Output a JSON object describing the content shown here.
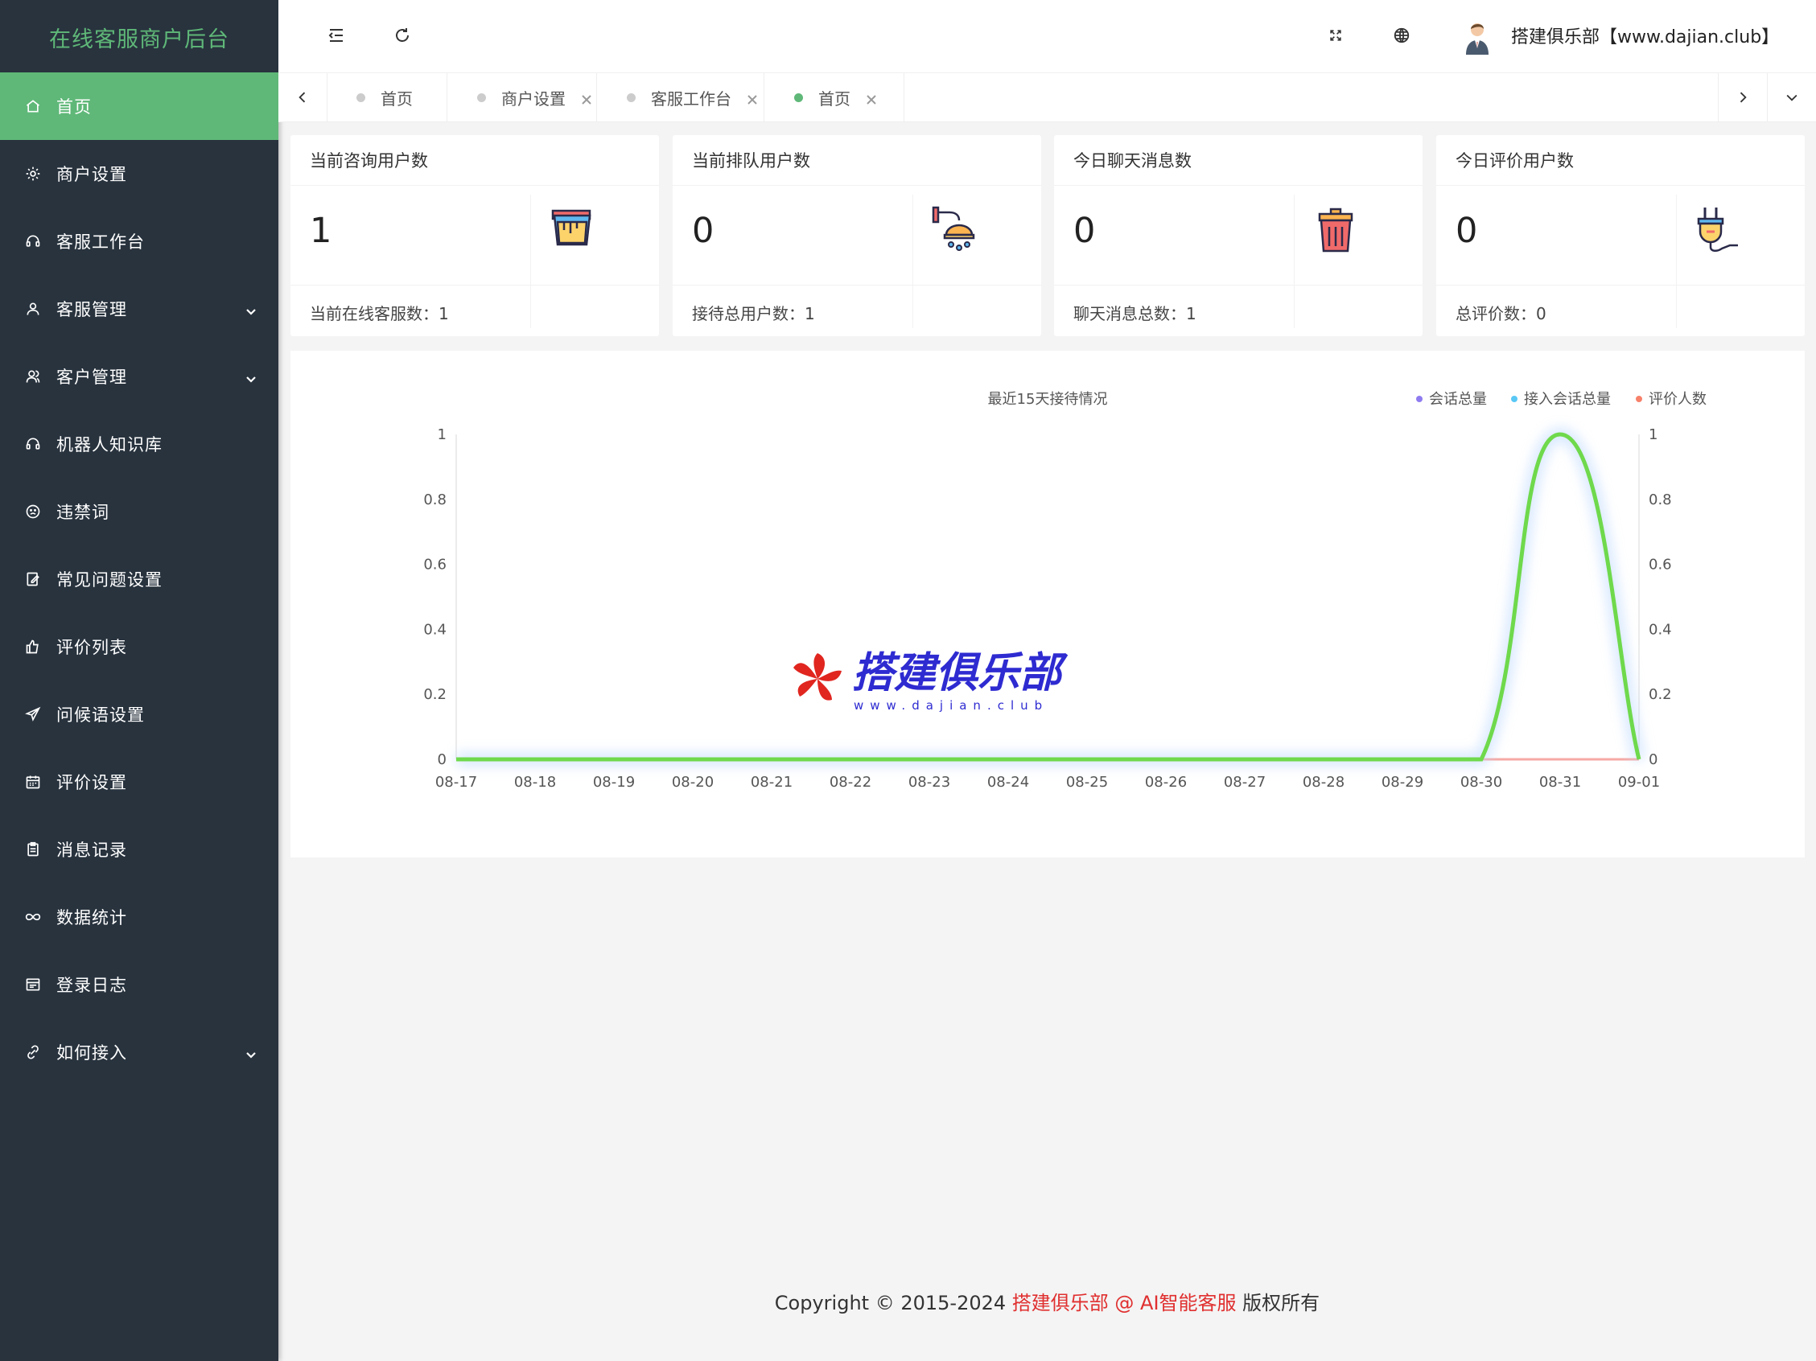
{
  "app": {
    "title": "在线客服商户后台"
  },
  "sidebar": {
    "items": [
      {
        "label": "首页",
        "icon": "home-icon",
        "active": true,
        "expandable": false
      },
      {
        "label": "商户设置",
        "icon": "gear-icon",
        "active": false,
        "expandable": false
      },
      {
        "label": "客服工作台",
        "icon": "headset-icon",
        "active": false,
        "expandable": false
      },
      {
        "label": "客服管理",
        "icon": "user-icon",
        "active": false,
        "expandable": true
      },
      {
        "label": "客户管理",
        "icon": "users-icon",
        "active": false,
        "expandable": true
      },
      {
        "label": "机器人知识库",
        "icon": "headset-icon",
        "active": false,
        "expandable": false
      },
      {
        "label": "违禁词",
        "icon": "face-icon",
        "active": false,
        "expandable": false
      },
      {
        "label": "常见问题设置",
        "icon": "edit-icon",
        "active": false,
        "expandable": false
      },
      {
        "label": "评价列表",
        "icon": "thumb-up-icon",
        "active": false,
        "expandable": false
      },
      {
        "label": "问候语设置",
        "icon": "send-icon",
        "active": false,
        "expandable": false
      },
      {
        "label": "评价设置",
        "icon": "calendar-icon",
        "active": false,
        "expandable": false
      },
      {
        "label": "消息记录",
        "icon": "clipboard-icon",
        "active": false,
        "expandable": false
      },
      {
        "label": "数据统计",
        "icon": "infinity-icon",
        "active": false,
        "expandable": false
      },
      {
        "label": "登录日志",
        "icon": "window-icon",
        "active": false,
        "expandable": false
      },
      {
        "label": "如何接入",
        "icon": "link-icon",
        "active": false,
        "expandable": true
      }
    ]
  },
  "header": {
    "user_name": "搭建俱乐部【www.dajian.club】"
  },
  "tabs": [
    {
      "label": "首页",
      "active": false,
      "closable": false
    },
    {
      "label": "商户设置",
      "active": false,
      "closable": true
    },
    {
      "label": "客服工作台",
      "active": false,
      "closable": true
    },
    {
      "label": "首页",
      "active": true,
      "closable": true
    }
  ],
  "cards": [
    {
      "title": "当前咨询用户数",
      "value": "1",
      "footer": "当前在线客服数：1",
      "icon": "paint-bucket-icon"
    },
    {
      "title": "当前排队用户数",
      "value": "0",
      "footer": "接待总用户数：1",
      "icon": "shower-icon"
    },
    {
      "title": "今日聊天消息数",
      "value": "0",
      "footer": "聊天消息总数：1",
      "icon": "trash-can-icon"
    },
    {
      "title": "今日评价用户数",
      "value": "0",
      "footer": "总评价数：0",
      "icon": "plug-icon"
    }
  ],
  "chart_data": {
    "type": "line",
    "title": "最近15天接待情况",
    "categories": [
      "08-17",
      "08-18",
      "08-19",
      "08-20",
      "08-21",
      "08-22",
      "08-23",
      "08-24",
      "08-25",
      "08-26",
      "08-27",
      "08-28",
      "08-29",
      "08-30",
      "08-31",
      "09-01"
    ],
    "series": [
      {
        "name": "会话总量",
        "color": "#8f7bf0",
        "values": [
          0,
          0,
          0,
          0,
          0,
          0,
          0,
          0,
          0,
          0,
          0,
          0,
          0,
          0,
          1,
          0
        ]
      },
      {
        "name": "接入会话总量",
        "color": "#59c8f5",
        "values": [
          0,
          0,
          0,
          0,
          0,
          0,
          0,
          0,
          0,
          0,
          0,
          0,
          0,
          0,
          1,
          0
        ]
      },
      {
        "name": "评价人数",
        "color": "#f7816b",
        "values": [
          0,
          0,
          0,
          0,
          0,
          0,
          0,
          0,
          0,
          0,
          0,
          0,
          0,
          0,
          0,
          0
        ]
      }
    ],
    "ylim": [
      0,
      1
    ],
    "yticks": [
      "0",
      "0.2",
      "0.4",
      "0.6",
      "0.8",
      "1"
    ],
    "y2ticks": [
      "0",
      "0.2",
      "0.4",
      "0.6",
      "0.8",
      "1"
    ],
    "legend_position": "top-right",
    "grid": false
  },
  "watermark": {
    "text": "搭建俱乐部",
    "url": "www.dajian.club"
  },
  "footer": {
    "prefix": "Copyright © 2015-2024 ",
    "brand": "搭建俱乐部 @ AI智能客服",
    "suffix": " 版权所有"
  }
}
